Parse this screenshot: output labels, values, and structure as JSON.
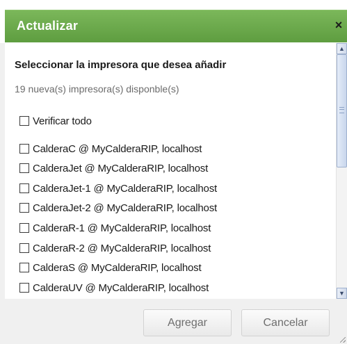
{
  "dialog": {
    "title": "Actualizar",
    "close_glyph": "×",
    "close_icon": "close-icon"
  },
  "content": {
    "heading": "Seleccionar la impresora que desea añadir",
    "subtext": "19 nueva(s) impresora(s) disponble(s)",
    "select_all_label": "Verificar todo",
    "printers": [
      "CalderaC @ MyCalderaRIP, localhost",
      "CalderaJet @ MyCalderaRIP, localhost",
      "CalderaJet-1 @ MyCalderaRIP, localhost",
      "CalderaJet-2 @ MyCalderaRIP, localhost",
      "CalderaR-1 @ MyCalderaRIP, localhost",
      "CalderaR-2 @ MyCalderaRIP, localhost",
      "CalderaS @ MyCalderaRIP, localhost",
      "CalderaUV @ MyCalderaRIP, localhost"
    ]
  },
  "footer": {
    "add_label": "Agregar",
    "cancel_label": "Cancelar"
  },
  "colors": {
    "titlebar": "#6aa84f",
    "title_text": "#ffffff"
  }
}
